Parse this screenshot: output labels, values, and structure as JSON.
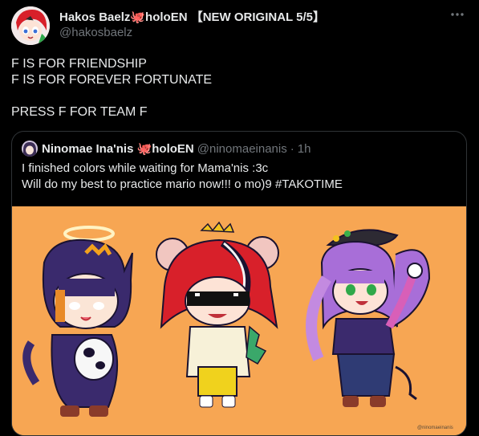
{
  "tweet": {
    "author_name": "Hakos Baelz🐙holoEN 【NEW ORIGINAL 5/5】",
    "author_handle": "@hakosbaelz",
    "text": "F IS FOR FRIENDSHIP\nF IS FOR FOREVER FORTUNATE\n\nPRESS F FOR TEAM F",
    "more_icon": "ellipsis-icon"
  },
  "quoted_tweet": {
    "author_name": "Ninomae Ina'nis 🐙holoEN",
    "author_handle": "@ninomaeinanis",
    "separator": "·",
    "time": "1h",
    "text": "I finished  colors while waiting for Mama'nis :3c\nWill do my best to practice mario now!!! o mo)9 #TAKOTIME",
    "media_signature": "@ninomaeinanis"
  },
  "colors": {
    "background": "#000000",
    "text": "#e7e9ea",
    "muted": "#71767b",
    "border": "#2f3336",
    "media_background": "#f7a653",
    "octopus": "#a35bd6"
  }
}
